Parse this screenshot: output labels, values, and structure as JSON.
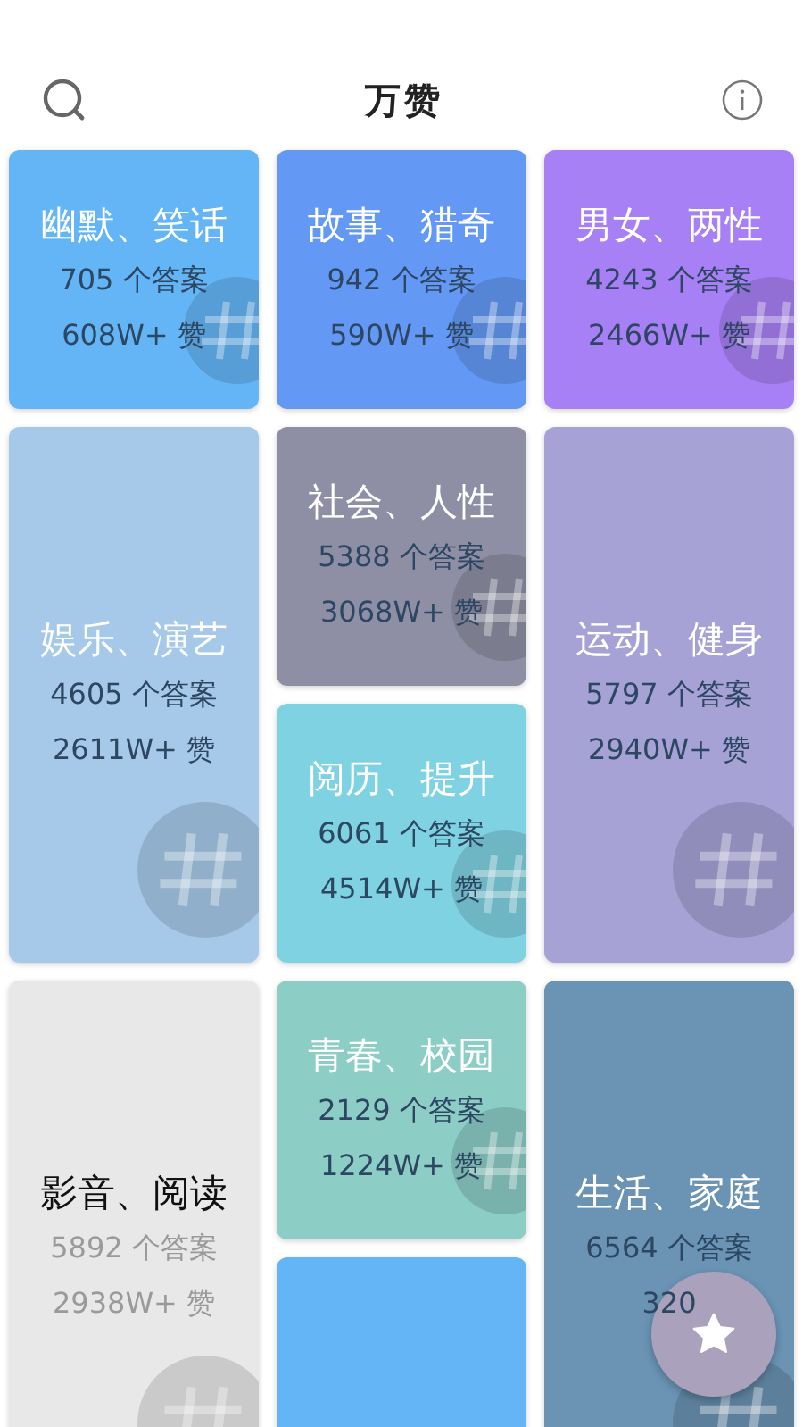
{
  "header": {
    "title": "万赞"
  },
  "columns": [
    [
      {
        "title": "幽默、笑话",
        "answers": "705 个答案",
        "likes": "608W+ 赞",
        "color": "#64b5f6",
        "kind": "short",
        "faded": false
      },
      {
        "title": "娱乐、演艺",
        "answers": "4605 个答案",
        "likes": "2611W+ 赞",
        "color": "#a6c9e9",
        "kind": "tall",
        "faded": false
      },
      {
        "title": "影音、阅读",
        "answers": "5892 个答案",
        "likes": "2938W+ 赞",
        "color": "#e8e8e8",
        "kind": "tall",
        "faded": true
      }
    ],
    [
      {
        "title": "故事、猎奇",
        "answers": "942 个答案",
        "likes": "590W+ 赞",
        "color": "#6399f5",
        "kind": "short",
        "faded": false
      },
      {
        "title": "社会、人性",
        "answers": "5388 个答案",
        "likes": "3068W+ 赞",
        "color": "#8e8fa4",
        "kind": "short",
        "faded": false
      },
      {
        "title": "阅历、提升",
        "answers": "6061 个答案",
        "likes": "4514W+ 赞",
        "color": "#7fd2e1",
        "kind": "short",
        "faded": false
      },
      {
        "title": "青春、校园",
        "answers": "2129 个答案",
        "likes": "1224W+ 赞",
        "color": "#8ccdc6",
        "kind": "short",
        "faded": false
      },
      {
        "color": "#64b5f6",
        "kind": "short"
      }
    ],
    [
      {
        "title": "男女、两性",
        "answers": "4243 个答案",
        "likes": "2466W+ 赞",
        "color": "#a780f5",
        "kind": "short",
        "faded": false
      },
      {
        "title": "运动、健身",
        "answers": "5797 个答案",
        "likes": "2940W+ 赞",
        "color": "#a6a2d6",
        "kind": "tall",
        "faded": false
      },
      {
        "title": "生活、家庭",
        "answers": "6564 个答案",
        "likes": "320",
        "color": "#6a93b4",
        "kind": "tall",
        "faded": false
      }
    ]
  ]
}
